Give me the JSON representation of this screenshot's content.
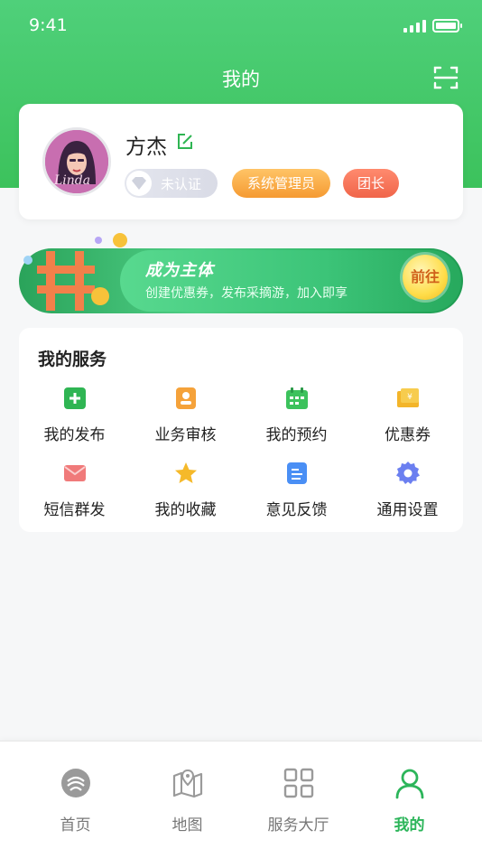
{
  "status_bar": {
    "time": "9:41"
  },
  "header": {
    "title": "我的"
  },
  "profile": {
    "name": "方杰",
    "avatar_caption": "Linda",
    "badges": {
      "unverified": "未认证",
      "admin": "系统管理员",
      "leader": "团长"
    }
  },
  "banner": {
    "title": "成为主体",
    "subtitle": "创建优惠券，发布采摘游，加入即享",
    "button": "前往"
  },
  "services": {
    "title": "我的服务",
    "items": [
      {
        "label": "我的发布",
        "icon": "publish-icon",
        "color": "#2fb553"
      },
      {
        "label": "业务审核",
        "icon": "review-icon",
        "color": "#f5a23a"
      },
      {
        "label": "我的预约",
        "icon": "calendar-icon",
        "color": "#3cc25c"
      },
      {
        "label": "优惠券",
        "icon": "coupon-icon",
        "color": "#f3b52a"
      },
      {
        "label": "短信群发",
        "icon": "sms-icon",
        "color": "#f06b6b"
      },
      {
        "label": "我的收藏",
        "icon": "star-icon",
        "color": "#f5b92a"
      },
      {
        "label": "意见反馈",
        "icon": "feedback-icon",
        "color": "#4a8ff5"
      },
      {
        "label": "通用设置",
        "icon": "settings-icon",
        "color": "#6b7ff0"
      }
    ]
  },
  "tabbar": {
    "items": [
      {
        "label": "首页",
        "icon": "home-icon",
        "active": false
      },
      {
        "label": "地图",
        "icon": "map-icon",
        "active": false
      },
      {
        "label": "服务大厅",
        "icon": "service-hall-icon",
        "active": false
      },
      {
        "label": "我的",
        "icon": "user-icon",
        "active": true
      }
    ]
  },
  "colors": {
    "brand_green": "#3cc25c",
    "active_tab": "#2cb55a"
  }
}
